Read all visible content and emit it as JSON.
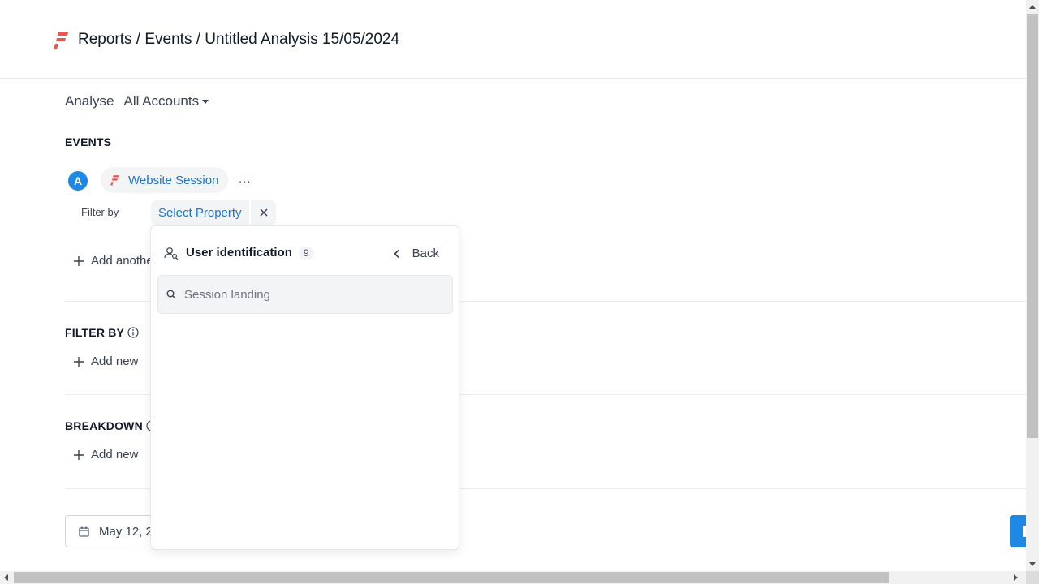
{
  "header": {
    "breadcrumb": "Reports / Events / Untitled Analysis 15/05/2024",
    "logo_icon": "brand-f-logo-icon",
    "logo_color": "#ef5350"
  },
  "analyse": {
    "label": "Analyse",
    "account_selector": "All Accounts"
  },
  "events": {
    "section_title": "EVENTS",
    "badge": "A",
    "event_name": "Website Session",
    "more_label": "...",
    "filter_by_label": "Filter by",
    "select_property_label": "Select Property",
    "add_another_label": "Add anothe"
  },
  "filter_by": {
    "section_title": "FILTER BY",
    "add_new_label": "Add new"
  },
  "breakdown": {
    "section_title": "BREAKDOWN",
    "add_new_label": "Add new"
  },
  "date_range": {
    "value": "May 12, 2"
  },
  "property_panel": {
    "category_title": "User identification",
    "category_count": "9",
    "back_label": "Back",
    "search_placeholder": "Session landing",
    "search_value": ""
  },
  "colors": {
    "accent_blue": "#1d73d6",
    "badge_blue": "#1e88e5",
    "brand_red": "#ef5350"
  }
}
